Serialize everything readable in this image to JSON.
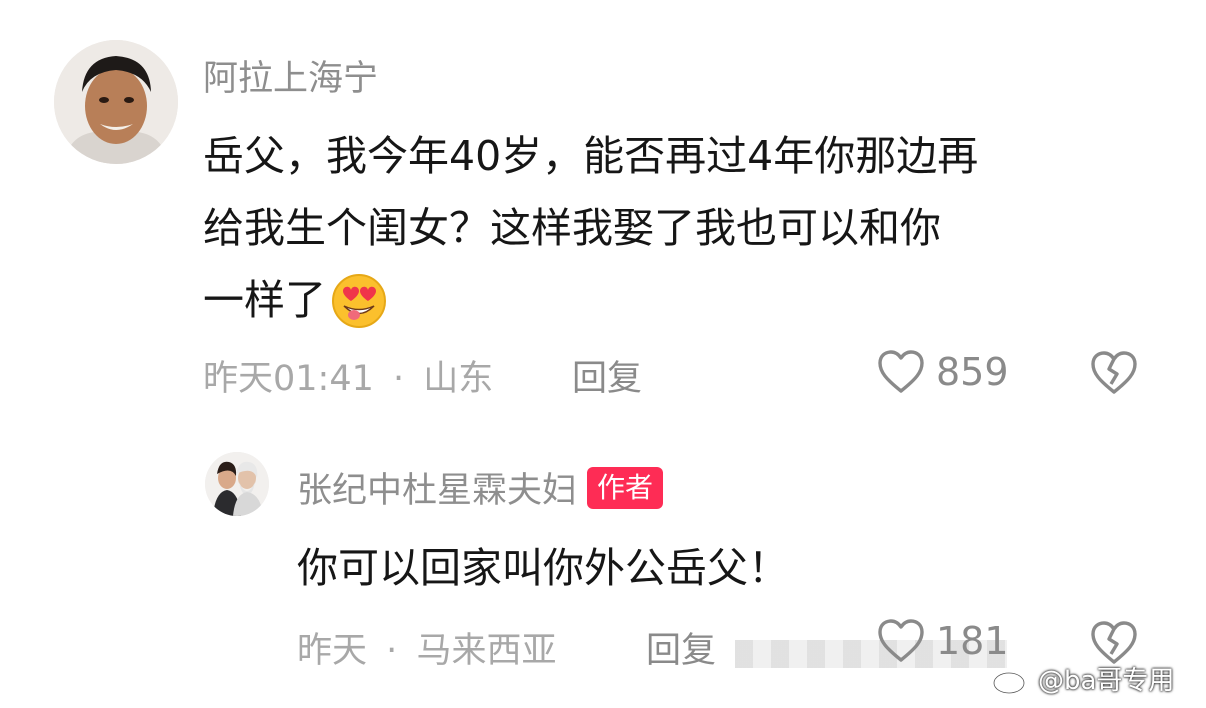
{
  "comment": {
    "username": "阿拉上海宁",
    "text_lines": [
      "岳父，我今年40岁，能否再过4年你那边再",
      "给我生个闺女？这样我娶了我也可以和你",
      "一样了"
    ],
    "emoji": "heart-eyes-emoji",
    "time": "昨天01:41",
    "location": "山东",
    "reply_label": "回复",
    "likes": "859"
  },
  "reply": {
    "username": "张纪中杜星霖夫妇",
    "badge": "作者",
    "text": "你可以回家叫你外公岳父！",
    "time": "昨天",
    "location": "马来西亚",
    "reply_label": "回复",
    "likes": "181"
  },
  "separator": "·",
  "watermark": "@ba哥专用",
  "colors": {
    "badge": "#fe2c55",
    "meta": "#a8a8a8",
    "name": "#8e8e8e"
  },
  "icons": [
    "heart-outline-icon",
    "broken-heart-icon",
    "weibo-logo-icon"
  ]
}
